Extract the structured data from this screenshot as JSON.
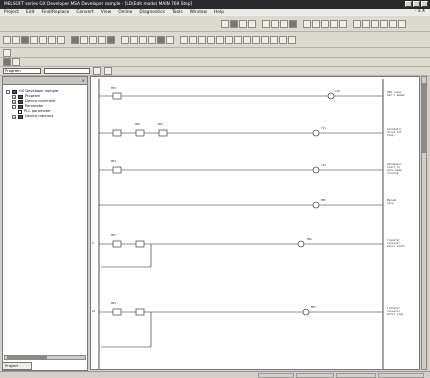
{
  "window": {
    "title": "MELSOFT series GX Developer  MSA Developer sample - [LD(Edit mode)  MAIN  769 Step]"
  },
  "menu": {
    "items": [
      "Project",
      "Edit",
      "Find/Replace",
      "Convert",
      "View",
      "Online",
      "Diagnostics",
      "Tools",
      "Window",
      "Help"
    ],
    "close": "- a X"
  },
  "toolbar": {
    "dropdown_program": "Program"
  },
  "nav": {
    "title": "",
    "items": [
      {
        "label": "GX Developer sample"
      },
      {
        "label": "Program"
      },
      {
        "label": "Device comment"
      },
      {
        "label": "Parameter"
      },
      {
        "label": "PLC parameter"
      },
      {
        "label": "Device memory"
      }
    ],
    "bottom_tab": "Project"
  },
  "ladder": {
    "contacts_top": [
      "M50",
      "M60",
      "M61",
      "M62",
      "M63",
      "M64"
    ],
    "step_numbers": [
      "0",
      "24"
    ],
    "coils": [
      "Y10",
      "Y11",
      "Y12",
      "M65",
      "M66",
      "M67"
    ],
    "comments": [
      "SSR relay\nSet / Reset",
      "Automatic\ndrive 1st\nstep",
      "Automatic\nstart in\nauto mode\nrunning",
      "Manual\nstop",
      "Transfer\nconveyor\nmotor start",
      "Transfer\nconveyor\nmotor stop"
    ]
  }
}
